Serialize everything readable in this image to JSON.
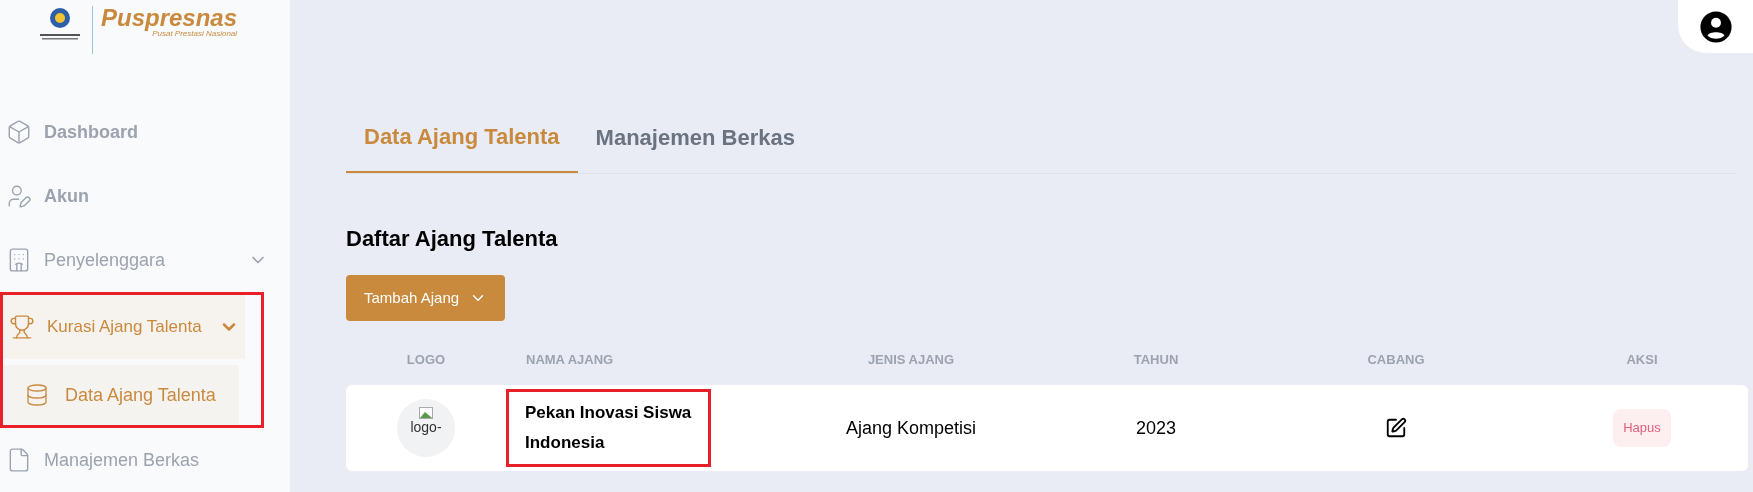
{
  "brand": {
    "name": "Puspresnas",
    "tagline": "Pusat Prestasi Nasional"
  },
  "sidebar": {
    "items": [
      {
        "label": "Dashboard",
        "kind": "dashboard",
        "selected": false,
        "highlighted": false
      },
      {
        "label": "Akun",
        "kind": "account",
        "selected": false,
        "highlighted": false
      },
      {
        "label": "Penyelenggara",
        "kind": "organizer",
        "selected": false,
        "expanded": false,
        "highlighted": false
      },
      {
        "label": "Kurasi Ajang Talenta",
        "kind": "trophy",
        "selected": true,
        "expanded": true,
        "highlighted": true,
        "children": [
          {
            "label": "Data Ajang Talenta",
            "kind": "database",
            "selected": true
          }
        ]
      },
      {
        "label": "Manajemen Berkas",
        "kind": "file",
        "selected": false,
        "highlighted": false
      }
    ]
  },
  "tabs": [
    {
      "label": "Data Ajang Talenta",
      "selected": true
    },
    {
      "label": "Manajemen Berkas",
      "selected": false
    }
  ],
  "section_title": "Daftar Ajang Talenta",
  "add_button": "Tambah Ajang",
  "table": {
    "columns": [
      "LOGO",
      "NAMA AJANG",
      "JENIS AJANG",
      "TAHUN",
      "CABANG",
      "AKSI"
    ],
    "rows": [
      {
        "logo_alt": "logo-",
        "name": "Pekan Inovasi Siswa Indonesia",
        "name_highlighted": true,
        "type": "Ajang Kompetisi",
        "year": "2023",
        "action": "Hapus"
      }
    ]
  }
}
